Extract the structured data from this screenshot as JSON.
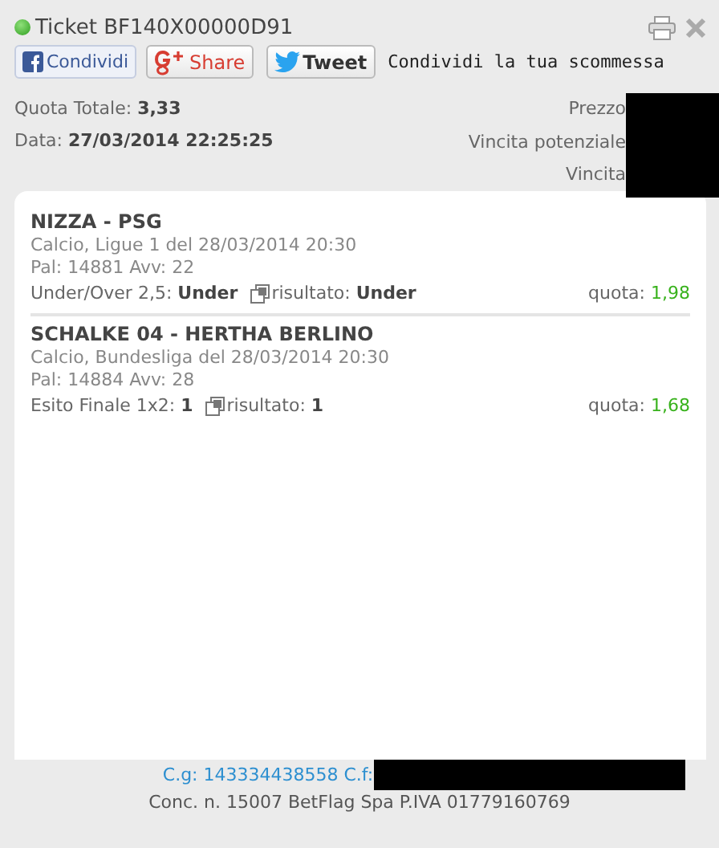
{
  "header": {
    "title": "Ticket BF140X00000D91",
    "share": [
      {
        "kind": "facebook",
        "label": "Condividi"
      },
      {
        "kind": "google",
        "label": "Share"
      },
      {
        "kind": "twitter",
        "label": "Tweet"
      }
    ],
    "share_caption": "Condividi la tua scommessa"
  },
  "summary": {
    "left": [
      {
        "label": "Quota Totale:",
        "value": "3,33"
      },
      {
        "label": "Data:",
        "value": "27/03/2014 22:25:25"
      }
    ],
    "right": [
      "Prezzo",
      "Vincita potenziale",
      "Vincita"
    ]
  },
  "events": [
    {
      "match": "NIZZA - PSG",
      "info": "Calcio, Ligue 1 del 28/03/2014 20:30",
      "pal": "Pal: 14881 Avv: 22",
      "market": "Under/Over 2,5:",
      "pick": "Under",
      "result_label": "risultato:",
      "result": "Under",
      "quota_label": "quota:",
      "quota": "1,98"
    },
    {
      "match": "SCHALKE 04 - HERTHA BERLINO",
      "info": "Calcio, Bundesliga del 28/03/2014 20:30",
      "pal": "Pal: 14884 Avv: 28",
      "market": "Esito Finale 1x2:",
      "pick": "1",
      "result_label": "risultato:",
      "result": "1",
      "quota_label": "quota:",
      "quota": "1,68"
    }
  ],
  "footer": {
    "codes": "C.g: 143334438558 C.f:",
    "concession": "Conc. n. 15007 BetFlag Spa P.IVA 01779160769"
  }
}
